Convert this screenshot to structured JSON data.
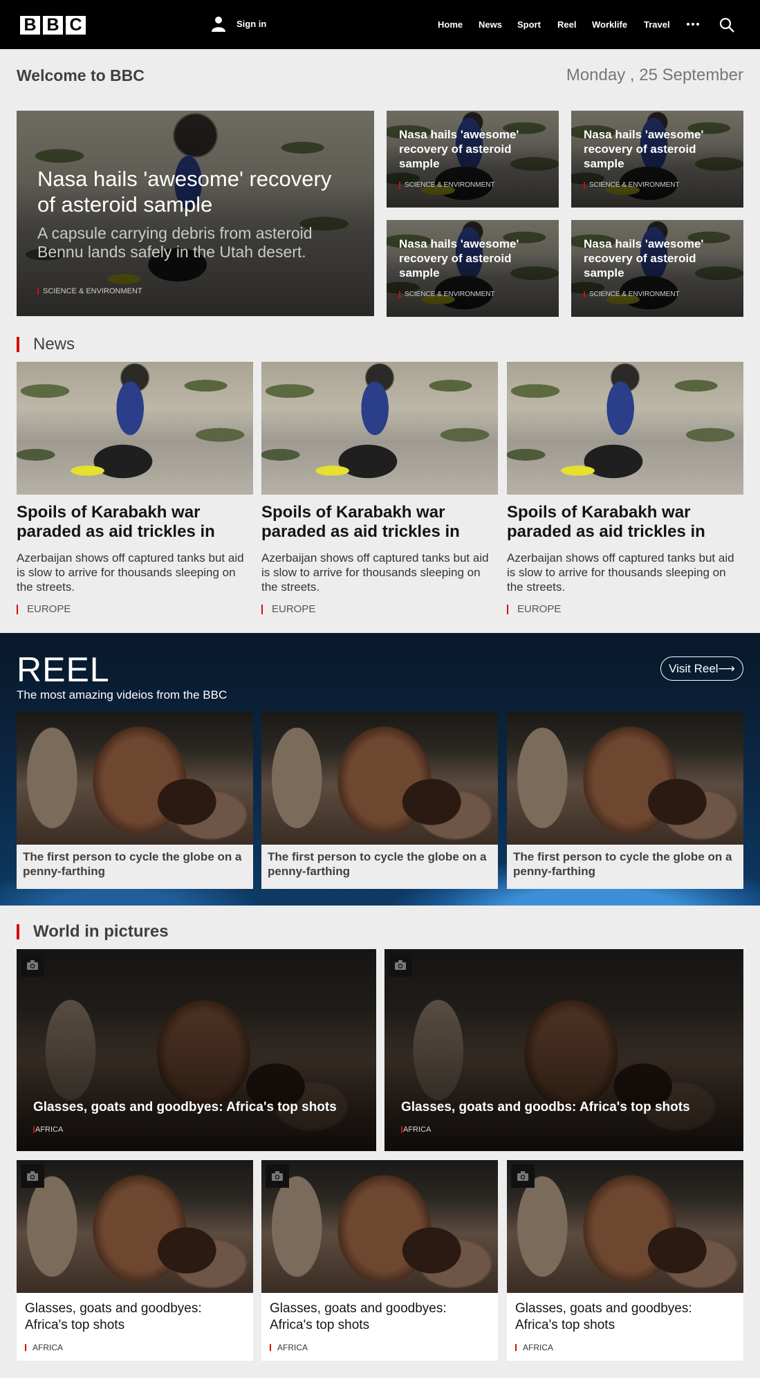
{
  "header": {
    "logo_letters": [
      "B",
      "B",
      "C"
    ],
    "signin_label": "Sign in",
    "nav": [
      "Home",
      "News",
      "Sport",
      "Reel",
      "Worklife",
      "Travel"
    ]
  },
  "welcome": {
    "title": "Welcome to BBC",
    "date": "Monday , 25 September"
  },
  "hero": {
    "title": "Nasa hails 'awesome' recovery of asteroid sample",
    "summary": "A capsule carrying debris from asteroid Bennu lands safely in the Utah desert.",
    "tag": "SCIENCE & ENVIRONMENT"
  },
  "top_stories": [
    {
      "title": "Nasa hails 'awesome' recovery of asteroid sample",
      "tag": "SCIENCE & ENVIRONMENT"
    },
    {
      "title": "Nasa hails 'awesome' recovery of asteroid sample",
      "tag": "SCIENCE & ENVIRONMENT"
    },
    {
      "title": "Nasa hails 'awesome' recovery of asteroid sample",
      "tag": "SCIENCE & ENVIRONMENT"
    },
    {
      "title": "Nasa hails 'awesome' recovery of asteroid sample",
      "tag": "SCIENCE & ENVIRONMENT"
    }
  ],
  "news": {
    "heading": "News",
    "cards": [
      {
        "title": "Spoils of Karabakh war paraded as aid trickles in",
        "summary": "Azerbaijan shows off captured tanks but aid is slow to arrive for thousands sleeping on the streets.",
        "tag": "EUROPE"
      },
      {
        "title": "Spoils of Karabakh war paraded as aid trickles in",
        "summary": "Azerbaijan shows off captured tanks but aid is slow to arrive for thousands sleeping on the streets.",
        "tag": "EUROPE"
      },
      {
        "title": "Spoils of Karabakh war paraded as aid trickles in",
        "summary": "Azerbaijan shows off captured tanks but aid is slow to arrive for thousands sleeping on the streets.",
        "tag": "EUROPE"
      }
    ]
  },
  "reel": {
    "title": "REEL",
    "subtitle": "The most amazing videios from the BBC",
    "button_label": "Visit Reel⟶",
    "cards": [
      {
        "title": "The first person to cycle the globe on a penny-farthing"
      },
      {
        "title": "The first person to cycle the globe on a penny-farthing"
      },
      {
        "title": "The first person to cycle the globe on a penny-farthing"
      }
    ]
  },
  "world_pictures": {
    "heading": "World in pictures",
    "big": [
      {
        "title": "Glasses, goats and goodbyes: Africa's top shots",
        "tag": "AFRICA"
      },
      {
        "title": "Glasses, goats and goodbs: Africa's top shots",
        "tag": "AFRICA"
      }
    ],
    "small": [
      {
        "title": "Glasses, goats and goodbyes: Africa's top shots",
        "tag": "AFRICA"
      },
      {
        "title": "Glasses, goats and goodbyes: Africa's top shots",
        "tag": "AFRICA"
      },
      {
        "title": "Glasses, goats and goodbyes: Africa's top shots",
        "tag": "AFRICA"
      }
    ]
  },
  "colors": {
    "accent": "#d10d0d",
    "header_bg": "#000000",
    "page_bg": "#ededed",
    "reel_bg": "#0c2540"
  },
  "icons": [
    "user-icon",
    "more-icon",
    "search-icon",
    "camera-icon"
  ]
}
